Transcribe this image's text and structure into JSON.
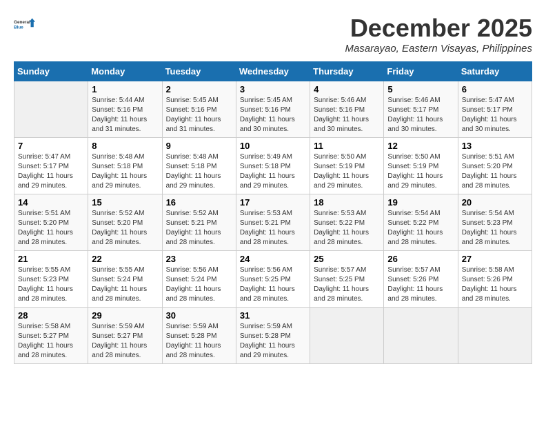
{
  "logo": {
    "line1": "General",
    "line2": "Blue"
  },
  "title": "December 2025",
  "subtitle": "Masarayao, Eastern Visayas, Philippines",
  "weekdays": [
    "Sunday",
    "Monday",
    "Tuesday",
    "Wednesday",
    "Thursday",
    "Friday",
    "Saturday"
  ],
  "weeks": [
    [
      {
        "day": "",
        "info": ""
      },
      {
        "day": "1",
        "info": "Sunrise: 5:44 AM\nSunset: 5:16 PM\nDaylight: 11 hours\nand 31 minutes."
      },
      {
        "day": "2",
        "info": "Sunrise: 5:45 AM\nSunset: 5:16 PM\nDaylight: 11 hours\nand 31 minutes."
      },
      {
        "day": "3",
        "info": "Sunrise: 5:45 AM\nSunset: 5:16 PM\nDaylight: 11 hours\nand 30 minutes."
      },
      {
        "day": "4",
        "info": "Sunrise: 5:46 AM\nSunset: 5:16 PM\nDaylight: 11 hours\nand 30 minutes."
      },
      {
        "day": "5",
        "info": "Sunrise: 5:46 AM\nSunset: 5:17 PM\nDaylight: 11 hours\nand 30 minutes."
      },
      {
        "day": "6",
        "info": "Sunrise: 5:47 AM\nSunset: 5:17 PM\nDaylight: 11 hours\nand 30 minutes."
      }
    ],
    [
      {
        "day": "7",
        "info": "Sunrise: 5:47 AM\nSunset: 5:17 PM\nDaylight: 11 hours\nand 29 minutes."
      },
      {
        "day": "8",
        "info": "Sunrise: 5:48 AM\nSunset: 5:18 PM\nDaylight: 11 hours\nand 29 minutes."
      },
      {
        "day": "9",
        "info": "Sunrise: 5:48 AM\nSunset: 5:18 PM\nDaylight: 11 hours\nand 29 minutes."
      },
      {
        "day": "10",
        "info": "Sunrise: 5:49 AM\nSunset: 5:18 PM\nDaylight: 11 hours\nand 29 minutes."
      },
      {
        "day": "11",
        "info": "Sunrise: 5:50 AM\nSunset: 5:19 PM\nDaylight: 11 hours\nand 29 minutes."
      },
      {
        "day": "12",
        "info": "Sunrise: 5:50 AM\nSunset: 5:19 PM\nDaylight: 11 hours\nand 29 minutes."
      },
      {
        "day": "13",
        "info": "Sunrise: 5:51 AM\nSunset: 5:20 PM\nDaylight: 11 hours\nand 28 minutes."
      }
    ],
    [
      {
        "day": "14",
        "info": "Sunrise: 5:51 AM\nSunset: 5:20 PM\nDaylight: 11 hours\nand 28 minutes."
      },
      {
        "day": "15",
        "info": "Sunrise: 5:52 AM\nSunset: 5:20 PM\nDaylight: 11 hours\nand 28 minutes."
      },
      {
        "day": "16",
        "info": "Sunrise: 5:52 AM\nSunset: 5:21 PM\nDaylight: 11 hours\nand 28 minutes."
      },
      {
        "day": "17",
        "info": "Sunrise: 5:53 AM\nSunset: 5:21 PM\nDaylight: 11 hours\nand 28 minutes."
      },
      {
        "day": "18",
        "info": "Sunrise: 5:53 AM\nSunset: 5:22 PM\nDaylight: 11 hours\nand 28 minutes."
      },
      {
        "day": "19",
        "info": "Sunrise: 5:54 AM\nSunset: 5:22 PM\nDaylight: 11 hours\nand 28 minutes."
      },
      {
        "day": "20",
        "info": "Sunrise: 5:54 AM\nSunset: 5:23 PM\nDaylight: 11 hours\nand 28 minutes."
      }
    ],
    [
      {
        "day": "21",
        "info": "Sunrise: 5:55 AM\nSunset: 5:23 PM\nDaylight: 11 hours\nand 28 minutes."
      },
      {
        "day": "22",
        "info": "Sunrise: 5:55 AM\nSunset: 5:24 PM\nDaylight: 11 hours\nand 28 minutes."
      },
      {
        "day": "23",
        "info": "Sunrise: 5:56 AM\nSunset: 5:24 PM\nDaylight: 11 hours\nand 28 minutes."
      },
      {
        "day": "24",
        "info": "Sunrise: 5:56 AM\nSunset: 5:25 PM\nDaylight: 11 hours\nand 28 minutes."
      },
      {
        "day": "25",
        "info": "Sunrise: 5:57 AM\nSunset: 5:25 PM\nDaylight: 11 hours\nand 28 minutes."
      },
      {
        "day": "26",
        "info": "Sunrise: 5:57 AM\nSunset: 5:26 PM\nDaylight: 11 hours\nand 28 minutes."
      },
      {
        "day": "27",
        "info": "Sunrise: 5:58 AM\nSunset: 5:26 PM\nDaylight: 11 hours\nand 28 minutes."
      }
    ],
    [
      {
        "day": "28",
        "info": "Sunrise: 5:58 AM\nSunset: 5:27 PM\nDaylight: 11 hours\nand 28 minutes."
      },
      {
        "day": "29",
        "info": "Sunrise: 5:59 AM\nSunset: 5:27 PM\nDaylight: 11 hours\nand 28 minutes."
      },
      {
        "day": "30",
        "info": "Sunrise: 5:59 AM\nSunset: 5:28 PM\nDaylight: 11 hours\nand 28 minutes."
      },
      {
        "day": "31",
        "info": "Sunrise: 5:59 AM\nSunset: 5:28 PM\nDaylight: 11 hours\nand 29 minutes."
      },
      {
        "day": "",
        "info": ""
      },
      {
        "day": "",
        "info": ""
      },
      {
        "day": "",
        "info": ""
      }
    ]
  ]
}
